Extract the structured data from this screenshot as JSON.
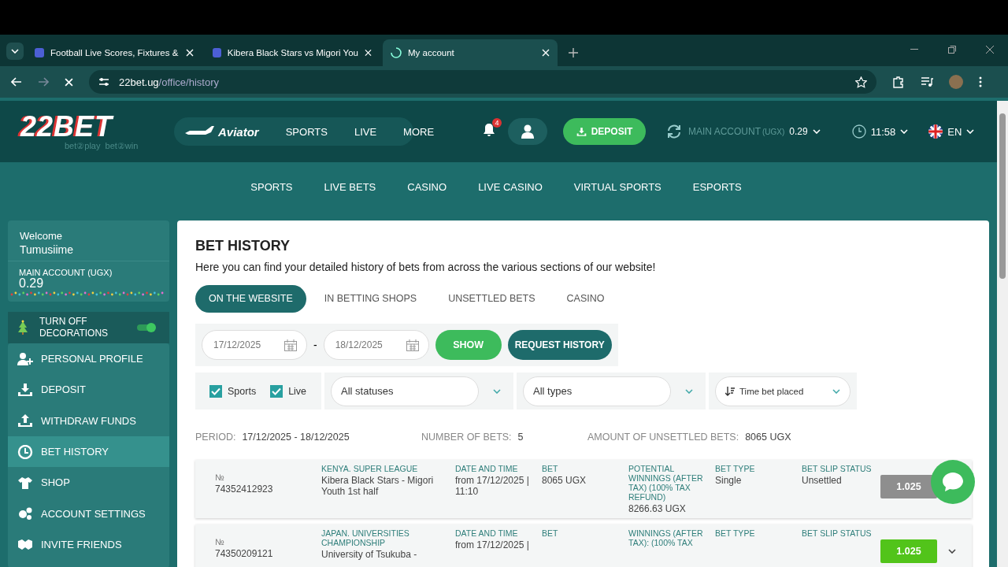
{
  "browser": {
    "tabs": [
      {
        "title": "Football Live Scores, Fixtures &",
        "selected": false
      },
      {
        "title": "Kibera Black Stars vs Migori You",
        "selected": false
      },
      {
        "title": "My account",
        "selected": true
      }
    ],
    "url_host": "22bet.ug",
    "url_path": "/office/history"
  },
  "header": {
    "logo": "22BET",
    "tagline": "bet②play  bet②win",
    "nav": [
      "Aviator",
      "SPORTS",
      "LIVE",
      "MORE"
    ],
    "notifications": "4",
    "deposit": "DEPOSIT",
    "account_label": "MAIN ACCOUNT",
    "currency": "(UGX)",
    "balance": "0.29",
    "time": "11:58",
    "language": "EN"
  },
  "subnav": [
    "SPORTS",
    "LIVE BETS",
    "CASINO",
    "LIVE CASINO",
    "VIRTUAL SPORTS",
    "ESPORTS"
  ],
  "sidebar": {
    "welcome": "Welcome",
    "name": "Tumusiime",
    "account_label": "MAIN ACCOUNT (UGX)",
    "balance": "0.29",
    "decorations": {
      "label": "TURN OFF DECORATIONS",
      "on": true
    },
    "menu": [
      {
        "label": "PERSONAL PROFILE",
        "selected": false
      },
      {
        "label": "DEPOSIT",
        "selected": false
      },
      {
        "label": "WITHDRAW FUNDS",
        "selected": false
      },
      {
        "label": "BET HISTORY",
        "selected": true
      },
      {
        "label": "SHOP",
        "selected": false
      },
      {
        "label": "ACCOUNT SETTINGS",
        "selected": false
      },
      {
        "label": "INVITE FRIENDS",
        "selected": false
      }
    ]
  },
  "content": {
    "title": "BET HISTORY",
    "subtitle": "Here you can find your detailed history of bets from across the various sections of our website!",
    "tabs": [
      {
        "label": "ON THE WEBSITE",
        "selected": true
      },
      {
        "label": "IN BETTING SHOPS",
        "selected": false
      },
      {
        "label": "UNSETTLED BETS",
        "selected": false
      },
      {
        "label": "CASINO",
        "selected": false
      }
    ],
    "date_from": "17/12/2025",
    "date_to": "18/12/2025",
    "separator": "-",
    "show_button": "SHOW",
    "request_button": "REQUEST HISTORY",
    "checkboxes": [
      {
        "label": "Sports",
        "checked": true
      },
      {
        "label": "Live",
        "checked": true
      }
    ],
    "status_select": "All statuses",
    "type_select": "All types",
    "sort_select": "Time bet placed",
    "summary": [
      {
        "label": "PERIOD:",
        "value": "17/12/2025 - 18/12/2025"
      },
      {
        "label": "NUMBER OF BETS:",
        "value": "5"
      },
      {
        "label": "AMOUNT OF UNSETTLED BETS:",
        "value": "8065 UGX"
      }
    ],
    "bets": [
      {
        "number_label": "№",
        "number": "74352412923",
        "league": "KENYA. SUPER LEAGUE",
        "match": "Kibera Black Stars - Migori Youth 1st half",
        "date_label": "DATE AND TIME",
        "date": "from 17/12/2025 | 11:10",
        "bet_label": "BET",
        "bet": "8065 UGX",
        "winnings_label": "POTENTIAL WINNINGS (AFTER TAX) (100% TAX REFUND)",
        "winnings": "8266.63 UGX",
        "type_label": "BET TYPE",
        "type": "Single",
        "status_label": "BET SLIP STATUS",
        "status": "Unsettled",
        "kind": "unsettled",
        "odds": "1.025",
        "expand_button": false
      },
      {
        "number_label": "№",
        "number": "74350209121",
        "league": "JAPAN. UNIVERSITIES CHAMPIONSHIP",
        "match": "University of Tsukuba -",
        "date_label": "DATE AND TIME",
        "date": "from 17/12/2025 |",
        "bet_label": "BET",
        "winnings_label": "WINNINGS (AFTER TAX): (100% TAX",
        "type_label": "BET TYPE",
        "status_label": "BET SLIP STATUS",
        "kind": "win",
        "odds": "1.025",
        "expand_button": true
      }
    ]
  }
}
